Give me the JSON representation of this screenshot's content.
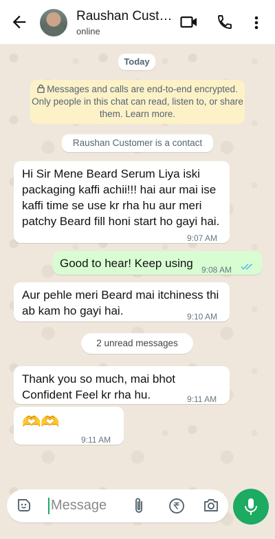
{
  "header": {
    "contact_name": "Raushan Custo…",
    "status": "online"
  },
  "chat": {
    "date_label": "Today",
    "encryption_notice": "Messages and calls are end-to-end encrypted. Only people in this chat can read, listen to, or share them. Learn more.",
    "contact_notice": "Raushan Customer is a contact",
    "unread_label": "2 unread messages",
    "messages": [
      {
        "direction": "in",
        "text": "Hi Sir Mene Beard Serum Liya iski packaging kaffi achii!!! hai aur mai ise kaffi time se use kr rha hu aur meri patchy Beard fill honi start ho gayi hai.",
        "time": "9:07 AM"
      },
      {
        "direction": "out",
        "text": "Good to hear! Keep using",
        "time": "9:08 AM",
        "status": "read"
      },
      {
        "direction": "in",
        "text": "Aur pehle meri Beard mai itchiness thi ab kam ho gayi hai.",
        "time": "9:10 AM"
      },
      {
        "direction": "in",
        "text": "Thank you so much, mai bhot Confident Feel kr rha hu.",
        "time": "9:11 AM"
      },
      {
        "direction": "in",
        "text": "🫶🫶",
        "time": "9:11 AM"
      }
    ]
  },
  "composer": {
    "placeholder": "Message"
  },
  "colors": {
    "accent": "#1daa61",
    "outgoing_bubble": "#d9fdd3",
    "read_ticks": "#53bdeb",
    "encryption_bg": "#fdf1c8"
  },
  "icons": [
    "back-arrow-icon",
    "video-call-icon",
    "phone-icon",
    "more-vert-icon",
    "lock-icon",
    "sticker-icon",
    "attach-icon",
    "rupee-icon",
    "camera-icon",
    "mic-icon",
    "double-check-icon"
  ]
}
